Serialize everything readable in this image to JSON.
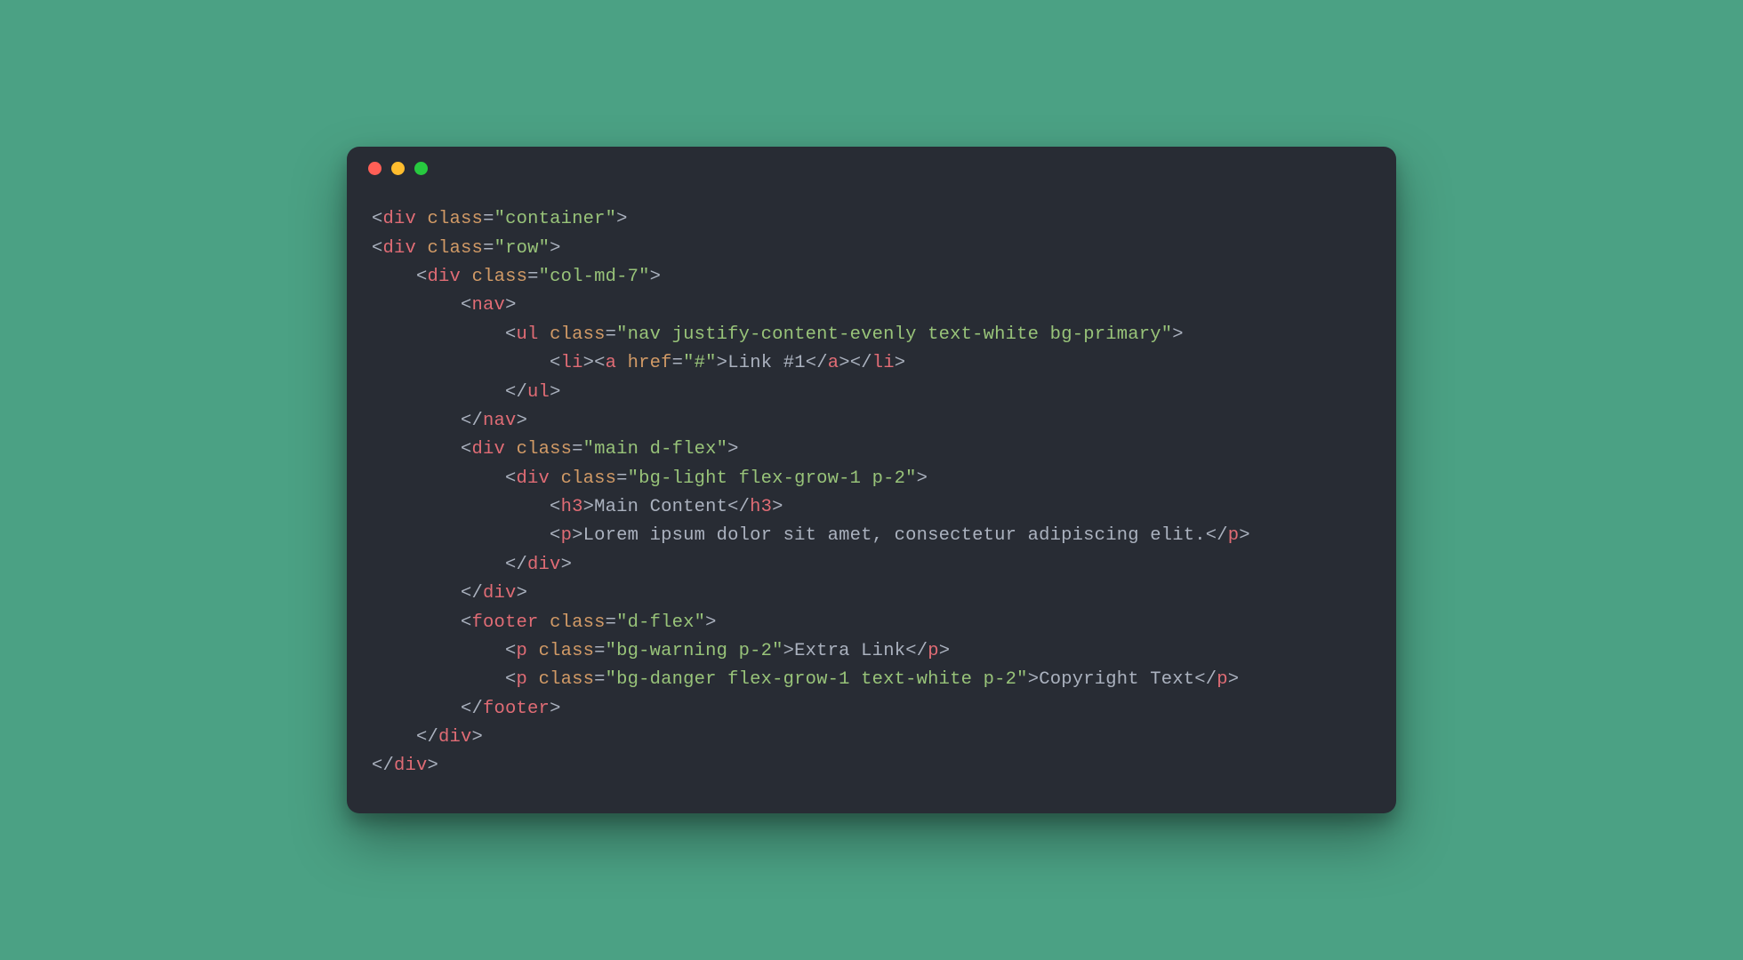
{
  "code": {
    "tags": {
      "div": "div",
      "nav": "nav",
      "ul": "ul",
      "li": "li",
      "a": "a",
      "h3": "h3",
      "p": "p",
      "footer": "footer"
    },
    "attrs": {
      "class": "class",
      "href": "href"
    },
    "values": {
      "container": "\"container\"",
      "row": "\"row\"",
      "col": "\"col-md-7\"",
      "ul_cls": "\"nav justify-content-evenly text-white bg-primary\"",
      "href_hash": "\"#\"",
      "main_cls": "\"main d-flex\"",
      "main_inner_cls": "\"bg-light flex-grow-1 p-2\"",
      "footer_cls": "\"d-flex\"",
      "p1_cls": "\"bg-warning p-2\"",
      "p2_cls": "\"bg-danger flex-grow-1 text-white p-2\""
    },
    "text": {
      "link1": "Link #1",
      "main_heading": "Main Content",
      "lorem": "Lorem ipsum dolor sit amet, consectetur adipiscing elit.",
      "extra_link": "Extra Link",
      "copyright": "Copyright Text"
    }
  }
}
